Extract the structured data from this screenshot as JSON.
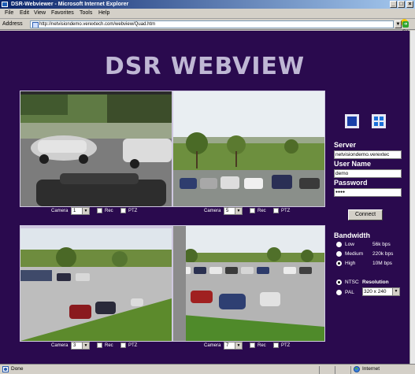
{
  "window": {
    "title": "DSR-Webviewer - Microsoft Internet Explorer",
    "controls": {
      "minimize": "_",
      "maximize": "□",
      "close": "×"
    }
  },
  "menu": [
    "File",
    "Edit",
    "View",
    "Favorites",
    "Tools",
    "Help"
  ],
  "address": {
    "label": "Address",
    "url": "http://netvisiondemo.verextech.com/webview/Quad.htm",
    "go_label": "Go"
  },
  "page": {
    "title": "DSR WEBVIEW",
    "cameras": [
      {
        "camera_label": "Camera",
        "camera_value": "1",
        "rec_label": "Rec",
        "ptz_label": "PTZ"
      },
      {
        "camera_label": "Camera",
        "camera_value": "5",
        "rec_label": "Rec",
        "ptz_label": "PTZ"
      },
      {
        "camera_label": "Camera",
        "camera_value": "3",
        "rec_label": "Rec",
        "ptz_label": "PTZ"
      },
      {
        "camera_label": "Camera",
        "camera_value": "7",
        "rec_label": "Rec",
        "ptz_label": "PTZ"
      }
    ],
    "login": {
      "server_label": "Server",
      "server_value": "netvisiondemo.verextec",
      "username_label": "User Name",
      "username_value": "demo",
      "password_label": "Password",
      "password_value": "●●●●",
      "connect_label": "Connect"
    },
    "bandwidth": {
      "label": "Bandwidth",
      "options": [
        {
          "name": "Low",
          "rate": "56k bps",
          "selected": false
        },
        {
          "name": "Medium",
          "rate": "220k bps",
          "selected": false
        },
        {
          "name": "High",
          "rate": "10M bps",
          "selected": true
        }
      ]
    },
    "video_format": {
      "ntsc_label": "NTSC",
      "pal_label": "PAL",
      "ntsc_selected": true,
      "resolution_label": "Resolution",
      "resolution_value": "320 x 240"
    }
  },
  "status": {
    "left": "Done",
    "zone": "Internet"
  },
  "colors": {
    "page_background": "#2a0a4e",
    "title_text": "#bfb7d4",
    "titlebar_start": "#0a246a"
  }
}
